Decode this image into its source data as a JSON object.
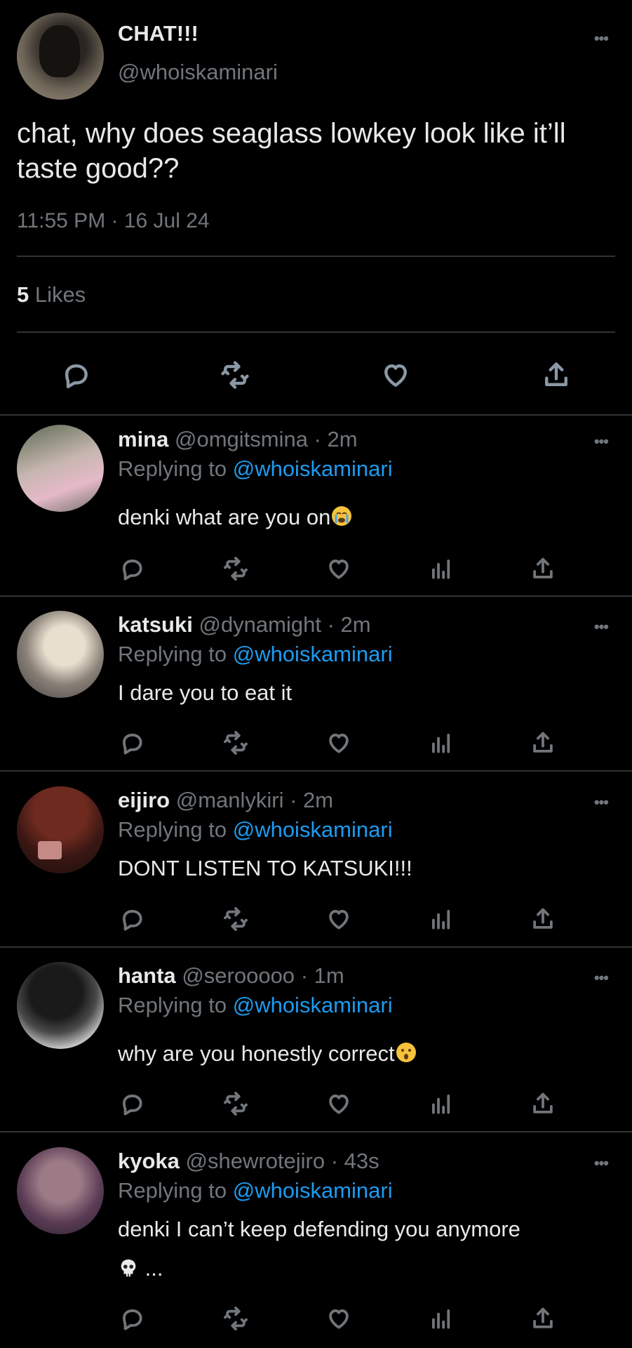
{
  "tweet": {
    "display_name": "CHAT!!!",
    "handle": "@whoiskaminari",
    "text": "chat, why does seaglass lowkey look like it’ll taste good??",
    "timestamp": "11:55 PM · 16 Jul 24",
    "likes_count": "5",
    "likes_label": "Likes"
  },
  "replying_prefix": "Replying to",
  "replying_handle": "@whoiskaminari",
  "replies": [
    {
      "name": "mina",
      "handle": "@omgitsmina",
      "time": "· 2m",
      "text": "denki what are you on",
      "emoji": "crying-face"
    },
    {
      "name": "katsuki",
      "handle": "@dynamight",
      "time": "· 2m",
      "text": "I dare you to eat it"
    },
    {
      "name": "eijiro",
      "handle": "@manlykiri",
      "time": "· 2m",
      "text": "DONT LISTEN TO KATSUKI!!!"
    },
    {
      "name": "hanta",
      "handle": "@serooooo",
      "time": "· 1m",
      "text": "why are you honestly correct",
      "emoji": "astonished-face"
    },
    {
      "name": "kyoka",
      "handle": "@shewrotejiro",
      "time": "· 43s",
      "text": "denki I can’t keep defending you anymore",
      "text2": "...",
      "emoji": "skull"
    }
  ],
  "colors": {
    "background": "#000000",
    "text": "#e7e9ea",
    "muted": "#71767b",
    "link": "#1d9bf0",
    "divider": "#2f3336"
  },
  "icons": [
    "reply-icon",
    "retweet-icon",
    "like-icon",
    "analytics-icon",
    "share-icon",
    "more-icon"
  ]
}
